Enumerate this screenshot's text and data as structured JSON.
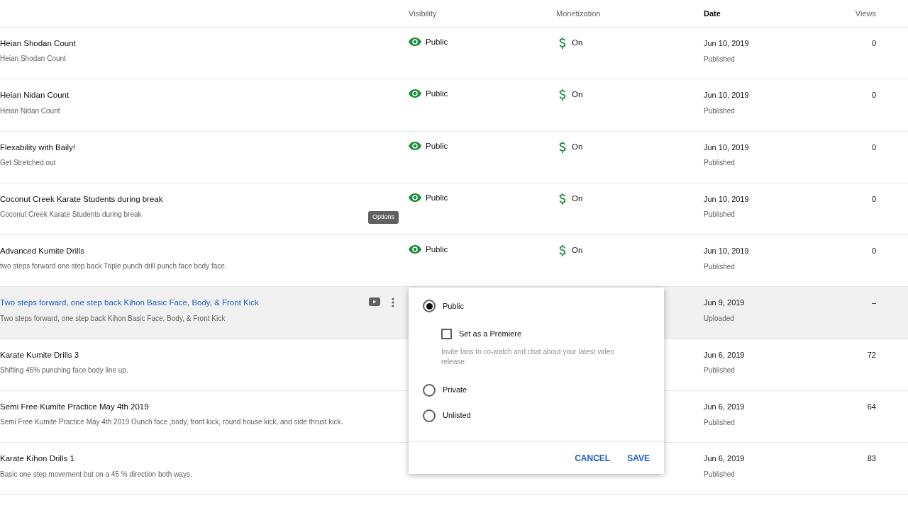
{
  "table": {
    "columns": [
      {
        "label": "Visibility",
        "sorted": false
      },
      {
        "label": "Monetization",
        "sorted": false
      },
      {
        "label": "Date",
        "sorted": true
      },
      {
        "label": "Views",
        "sorted": false
      }
    ],
    "rows": [
      {
        "title": "Heian Shodan Count",
        "description": "Heian Shodan Count",
        "visibility": "Public",
        "monetization": "On",
        "date": "Jun 10, 2019",
        "status": "Published",
        "views": "0",
        "selected": false
      },
      {
        "title": "Heian Nidan Count",
        "description": "Heian Nidan Count",
        "visibility": "Public",
        "monetization": "On",
        "date": "Jun 10, 2019",
        "status": "Published",
        "views": "0",
        "selected": false
      },
      {
        "title": "Flexability with Baily!",
        "description": "Get Stretched out",
        "visibility": "Public",
        "monetization": "On",
        "date": "Jun 10, 2019",
        "status": "Published",
        "views": "0",
        "selected": false
      },
      {
        "title": "Coconut Creek Karate Students during break",
        "description": "Coconut Creek Karate Students during break",
        "visibility": "Public",
        "monetization": "On",
        "date": "Jun 10, 2019",
        "status": "Published",
        "views": "0",
        "selected": false
      },
      {
        "title": "Advanced Kumite Drills",
        "description": "two steps forward one step back Triple punch drill punch face body face.",
        "visibility": "Public",
        "monetization": "On",
        "date": "Jun 10, 2019",
        "status": "Published",
        "views": "0",
        "selected": false
      },
      {
        "title": "Two steps forward, one step back Kihon Basic Face, Body, & Front Kick",
        "description": "Two steps forward, one step back Kihon Basic Face, Body, & Front Kick",
        "date": "Jun 9, 2019",
        "status": "Uploaded",
        "views": "–",
        "selected": true
      },
      {
        "title": "Karate Kumite Drills 3",
        "description": "Shifting 45% punching face body line up.",
        "date": "Jun 6, 2019",
        "status": "Published",
        "views": "72",
        "selected": false
      },
      {
        "title": "Semi Free Kumite Practice May 4th 2019",
        "description": "Semi Free Kumite Practice May 4th 2019 Ounch face ,body, front kick, round house kick, and side thrust kick.",
        "date": "Jun 6, 2019",
        "status": "Published",
        "views": "64",
        "selected": false
      },
      {
        "title": "Karate Kihon Drills 1",
        "description": "Basic one step movement but on a 45 % direction both ways.",
        "date": "Jun 6, 2019",
        "status": "Published",
        "views": "83",
        "selected": false
      }
    ]
  },
  "tooltip": {
    "text": "Options"
  },
  "visibility_menu": {
    "options": [
      {
        "label": "Public",
        "selected": true
      },
      {
        "label": "Private",
        "selected": false
      },
      {
        "label": "Unlisted",
        "selected": false
      }
    ],
    "premiere": {
      "label": "Set as a Premiere",
      "checked": false,
      "hint": "Invite fans to co-watch and chat about your latest video release."
    },
    "buttons": [
      "CANCEL",
      "SAVE"
    ]
  }
}
